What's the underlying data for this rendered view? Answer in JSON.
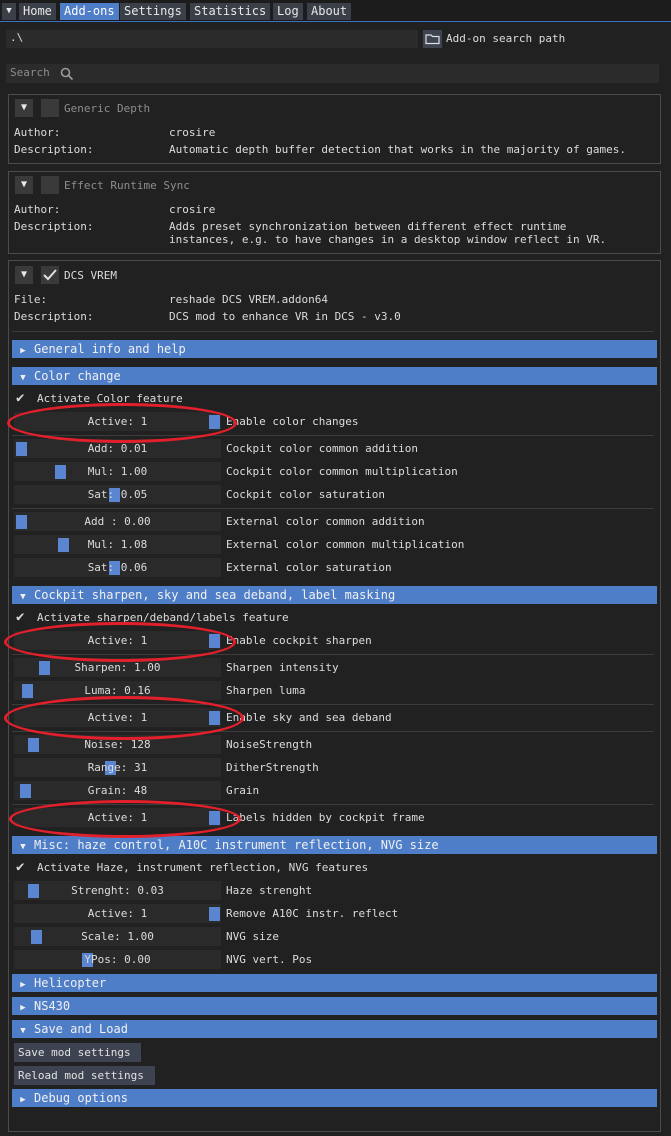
{
  "tabs": [
    "Home",
    "Add-ons",
    "Settings",
    "Statistics",
    "Log",
    "About"
  ],
  "path": {
    "value": ".\\",
    "button_label": "Add-on search path"
  },
  "search": {
    "placeholder": "Search"
  },
  "addons": [
    {
      "name": "Generic Depth",
      "rows": [
        {
          "k": "Author:",
          "v": "crosire"
        },
        {
          "k": "Description:",
          "v": "Automatic depth buffer detection that works in the majority of games."
        }
      ]
    },
    {
      "name": "Effect Runtime Sync",
      "rows": [
        {
          "k": "Author:",
          "v": "crosire"
        },
        {
          "k": "Description:",
          "v": "Adds preset synchronization between different effect runtime"
        },
        {
          "k": "",
          "v": "instances, e.g. to have changes in a desktop window reflect in VR."
        }
      ]
    },
    {
      "name": "DCS VREM",
      "rows": [
        {
          "k": "File:",
          "v": "reshade DCS VREM.addon64"
        },
        {
          "k": "Description:",
          "v": "DCS mod to enhance VR in DCS - v3.0"
        }
      ]
    }
  ],
  "sections": {
    "general": "General info and help",
    "color": "Color change",
    "sharpen": "Cockpit sharpen, sky and sea deband, label masking",
    "misc": "Misc: haze control, A10C instrument reflection, NVG size",
    "heli": "Helicopter",
    "ns430": "NS430",
    "save": "Save and Load",
    "debug": "Debug options"
  },
  "color": {
    "activate": "Activate Color feature",
    "active": {
      "value": "Active: 1",
      "label": "Enable color changes",
      "level": 1.0
    },
    "cockpit": [
      {
        "value": "Add: 0.01",
        "label": "Cockpit color common addition",
        "level": 0.0
      },
      {
        "value": "Mul: 1.00",
        "label": "Cockpit color common multiplication",
        "level": 0.2
      },
      {
        "value": "Sat: 0.05",
        "label": "Cockpit color saturation",
        "level": 0.48
      }
    ],
    "external": [
      {
        "value": "Add : 0.00",
        "label": "External color common addition",
        "level": 0.0
      },
      {
        "value": "Mul: 1.08",
        "label": "External color common multiplication",
        "level": 0.22
      },
      {
        "value": "Sat: 0.06",
        "label": "External color saturation",
        "level": 0.48
      }
    ]
  },
  "sharpen": {
    "activate": "Activate sharpen/deband/labels feature",
    "active_sharpen": {
      "value": "Active: 1",
      "label": "Enable cockpit sharpen",
      "level": 1.0
    },
    "intensity": {
      "value": "Sharpen: 1.00",
      "label": "Sharpen intensity",
      "level": 0.12
    },
    "luma": {
      "value": "Luma: 0.16",
      "label": "Sharpen luma",
      "level": 0.03
    },
    "active_deband": {
      "value": "Active: 1",
      "label": "Enable sky and sea deband",
      "level": 1.0
    },
    "noise": {
      "value": "Noise: 128",
      "label": "NoiseStrength",
      "level": 0.06
    },
    "range": {
      "value": "Range: 31",
      "label": "DitherStrength",
      "level": 0.46
    },
    "grain": {
      "value": "Grain: 48",
      "label": "Grain",
      "level": 0.02
    },
    "active_labels": {
      "value": "Active: 1",
      "label": "Labels hidden by cockpit frame",
      "level": 1.0
    }
  },
  "misc": {
    "activate": "Activate Haze, instrument reflection, NVG features",
    "haze": {
      "value": "Strenght: 0.03",
      "label": "Haze strenght",
      "level": 0.06
    },
    "reflect": {
      "value": "Active: 1",
      "label": "Remove A10C instr. reflect",
      "level": 1.0
    },
    "nvg": {
      "value": "Scale: 1.00",
      "label": "NVG size",
      "level": 0.08
    },
    "ypos": {
      "value": "YPos: 0.00",
      "label": "NVG vert. Pos",
      "level": 0.34
    }
  },
  "save": {
    "save_button": "Save mod settings",
    "reload_button": "Reload mod settings"
  }
}
